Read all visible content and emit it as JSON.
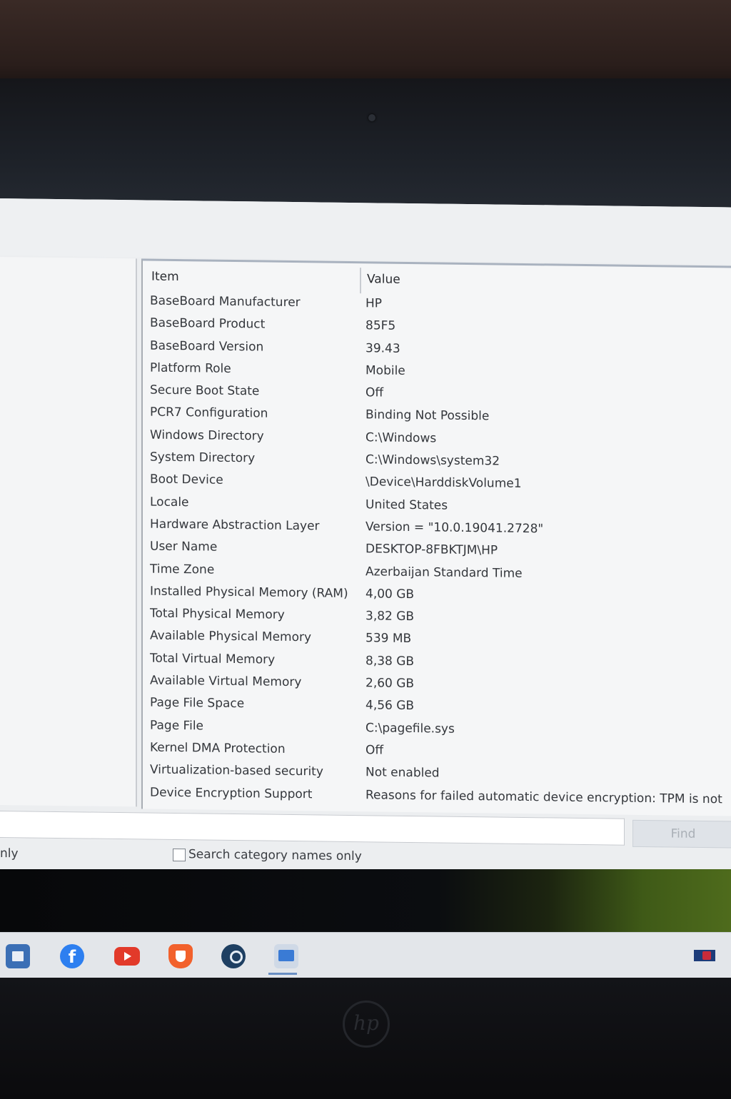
{
  "table": {
    "headers": {
      "item": "Item",
      "value": "Value"
    },
    "rows": [
      {
        "item": "BaseBoard Manufacturer",
        "value": "HP"
      },
      {
        "item": "BaseBoard Product",
        "value": "85F5"
      },
      {
        "item": "BaseBoard Version",
        "value": "39.43"
      },
      {
        "item": "Platform Role",
        "value": "Mobile"
      },
      {
        "item": "Secure Boot State",
        "value": "Off"
      },
      {
        "item": "PCR7 Configuration",
        "value": "Binding Not Possible"
      },
      {
        "item": "Windows Directory",
        "value": "C:\\Windows"
      },
      {
        "item": "System Directory",
        "value": "C:\\Windows\\system32"
      },
      {
        "item": "Boot Device",
        "value": "\\Device\\HarddiskVolume1"
      },
      {
        "item": "Locale",
        "value": "United States"
      },
      {
        "item": "Hardware Abstraction Layer",
        "value": "Version = \"10.0.19041.2728\""
      },
      {
        "item": "User Name",
        "value": "DESKTOP-8FBKTJM\\HP"
      },
      {
        "item": "Time Zone",
        "value": "Azerbaijan Standard Time"
      },
      {
        "item": "Installed Physical Memory (RAM)",
        "value": "4,00 GB"
      },
      {
        "item": "Total Physical Memory",
        "value": "3,82 GB"
      },
      {
        "item": "Available Physical Memory",
        "value": "539 MB"
      },
      {
        "item": "Total Virtual Memory",
        "value": "8,38 GB"
      },
      {
        "item": "Available Virtual Memory",
        "value": "2,60 GB"
      },
      {
        "item": "Page File Space",
        "value": "4,56 GB"
      },
      {
        "item": "Page File",
        "value": "C:\\pagefile.sys"
      },
      {
        "item": "Kernel DMA Protection",
        "value": "Off"
      },
      {
        "item": "Virtualization-based security",
        "value": "Not enabled"
      },
      {
        "item": "Device Encryption Support",
        "value": "Reasons for failed automatic device encryption: TPM is not"
      }
    ]
  },
  "find": {
    "input_value": "",
    "button_label": "Find",
    "option_left_label": "nly",
    "option_search_category_label": "Search category names only",
    "option_search_category_checked": false
  },
  "taskbar": {
    "icons": [
      "store-icon",
      "facebook-icon",
      "youtube-icon",
      "brave-icon",
      "steam-icon",
      "system-information-icon",
      "tray-flag-icon"
    ],
    "facebook_glyph": "f"
  },
  "hardware": {
    "logo_text": "hp"
  },
  "colors": {
    "accent": "#3a7bd5",
    "find_disabled": "#a9afb6"
  }
}
